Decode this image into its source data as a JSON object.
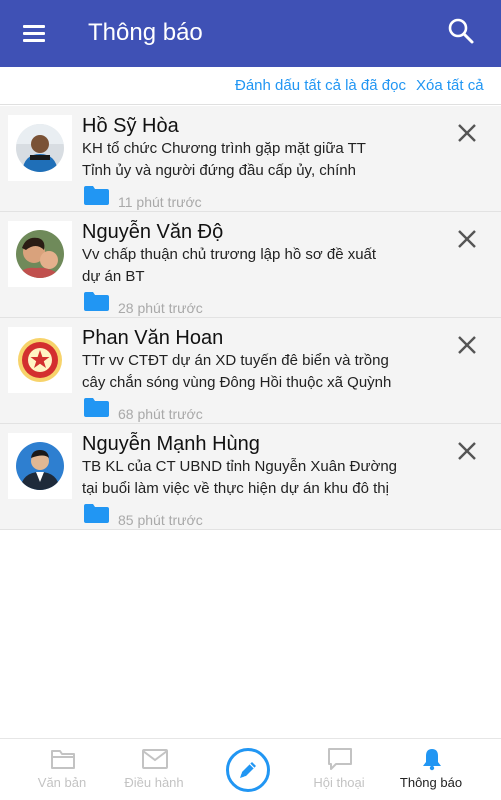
{
  "header": {
    "title": "Thông báo"
  },
  "actions": {
    "mark_all_read": "Đánh dấu tất cả là đã đọc",
    "clear_all": "Xóa tất cả"
  },
  "notifications": [
    {
      "sender": "Hồ Sỹ Hòa",
      "line1": "KH tổ chức Chương trình gặp mặt giữa TT",
      "line2": "Tỉnh ủy và người đứng đầu cấp ủy, chính",
      "time": "11 phút trước"
    },
    {
      "sender": "Nguyễn Văn Độ",
      "line1": "Vv chấp thuận chủ trương lập hồ sơ đề xuất",
      "line2": "dự án BT",
      "time": "28 phút trước"
    },
    {
      "sender": "Phan Văn Hoan",
      "line1": "TTr vv CTĐT dự án XD tuyến đê biển và trồng",
      "line2": "cây chắn sóng vùng Đông Hồi thuộc xã Quỳnh",
      "time": "68 phút trước"
    },
    {
      "sender": "Nguyễn Mạnh Hùng",
      "line1": "TB KL của CT UBND tỉnh Nguyễn Xuân Đường",
      "line2": "tại buổi làm việc về thực hiện dự án khu đô thị",
      "time": "85 phút trước"
    }
  ],
  "bottom_nav": {
    "documents": "Văn bản",
    "management": "Điều hành",
    "chat": "Hội thoại",
    "notifications": "Thông báo"
  },
  "colors": {
    "primary": "#3f51b5",
    "accent": "#2196f3",
    "item_bg": "#f4f4f4",
    "muted": "#c3c3c3"
  }
}
